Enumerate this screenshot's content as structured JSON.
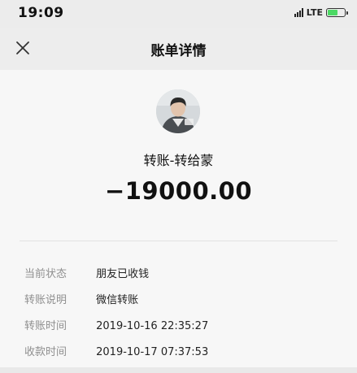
{
  "status_bar": {
    "time": "19:09",
    "network": "LTE"
  },
  "nav": {
    "title": "账单详情",
    "close_icon": "close-icon"
  },
  "transaction": {
    "title": "转账-转给蒙",
    "amount": "−19000.00"
  },
  "details": [
    {
      "label": "当前状态",
      "value": "朋友已收钱"
    },
    {
      "label": "转账说明",
      "value": "微信转账"
    },
    {
      "label": "转账时间",
      "value": "2019-10-16 22:35:27"
    },
    {
      "label": "收款时间",
      "value": "2019-10-17 07:37:53"
    }
  ]
}
